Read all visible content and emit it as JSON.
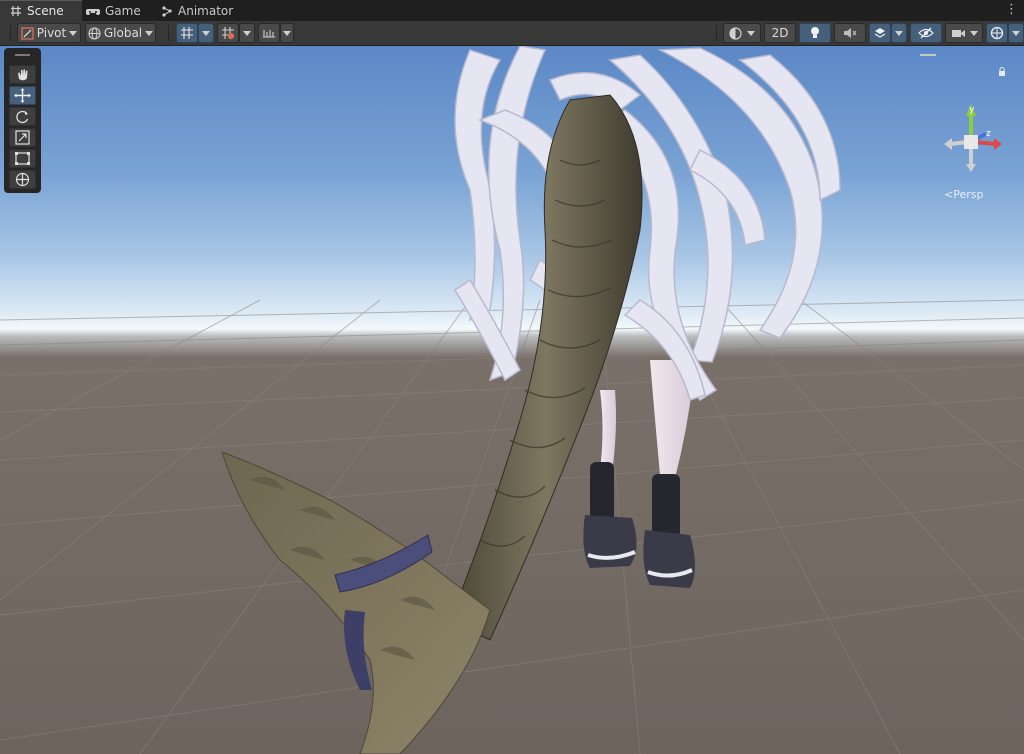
{
  "tabs": [
    {
      "label": "Scene",
      "icon": "grid-icon",
      "active": true
    },
    {
      "label": "Game",
      "icon": "gamepad-icon",
      "active": false
    },
    {
      "label": "Animator",
      "icon": "animator-icon",
      "active": false
    }
  ],
  "toolbar": {
    "pivot_label": "Pivot",
    "global_label": "Global",
    "mode_2d_label": "2D"
  },
  "tools": [
    "hand-tool",
    "move-tool",
    "rotate-tool",
    "scale-tool",
    "rect-tool",
    "transform-tool"
  ],
  "gizmo": {
    "axis_y": "y",
    "axis_z": "z",
    "axis_x": "x",
    "projection_label": "Persp"
  },
  "colors": {
    "accent": "#46607c",
    "toolbar_bg": "#383838",
    "tab_bg": "#1f1f1f"
  }
}
